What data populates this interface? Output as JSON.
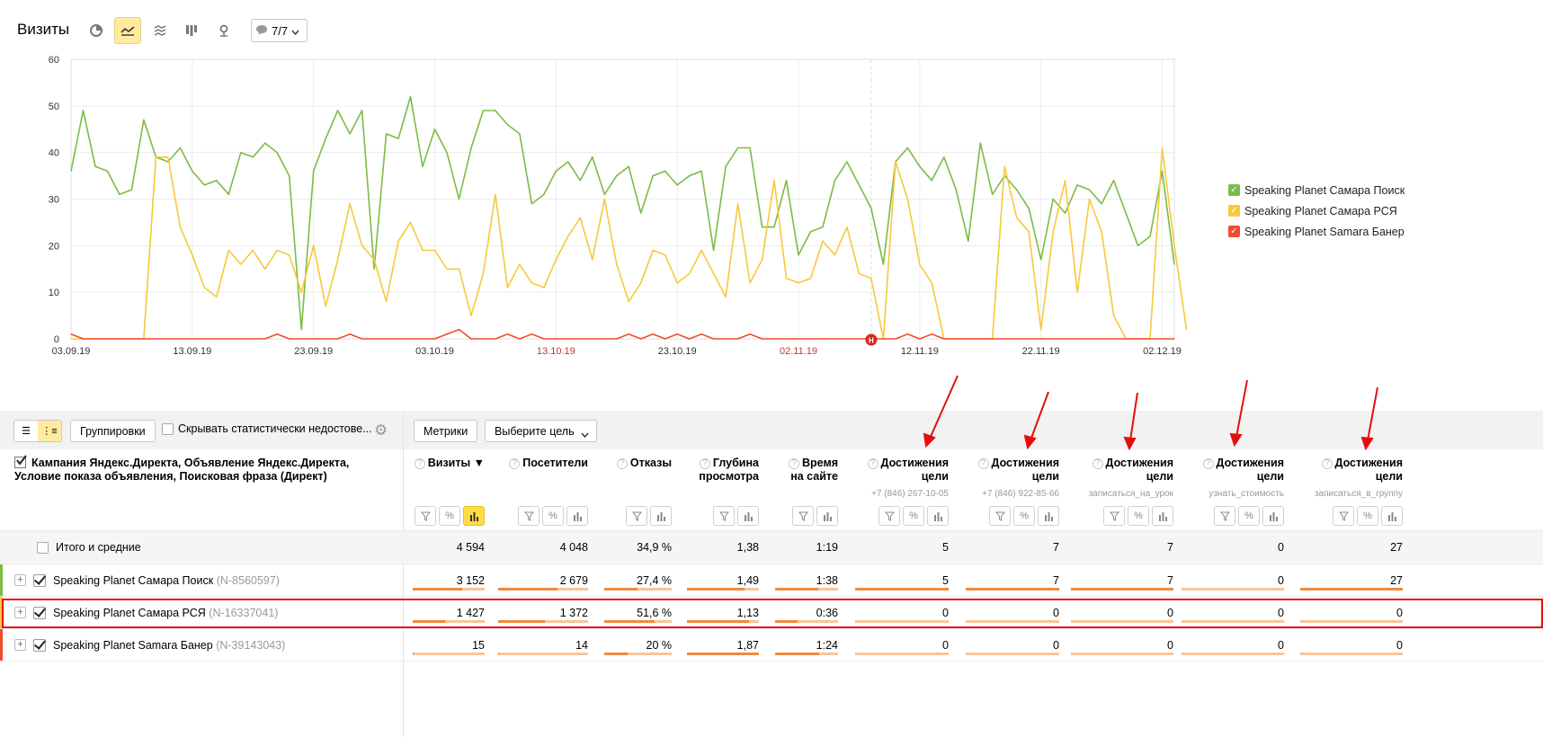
{
  "header": {
    "title": "Визиты",
    "annotations_label": "7/7",
    "tools": [
      "pie-chart-icon",
      "line-chart-icon",
      "area-chart-icon",
      "bar-chart-icon",
      "map-icon"
    ]
  },
  "chart_data": {
    "type": "line",
    "ylim": [
      0,
      60
    ],
    "yticks": [
      0,
      10,
      20,
      30,
      40,
      50,
      60
    ],
    "xtick_labels": [
      "03.09.19",
      "13.09.19",
      "23.09.19",
      "03.10.19",
      "13.10.19",
      "23.10.19",
      "02.11.19",
      "12.11.19",
      "22.11.19",
      "02.12.19"
    ],
    "weekend_labels": [
      "13.10.19",
      "02.11.19"
    ],
    "annotation_marker": "Н",
    "grid": true,
    "legend_position": "right",
    "series": [
      {
        "name": "Speaking Planet Самара Поиск",
        "color": "#7cbb45",
        "values": [
          36,
          49,
          37,
          36,
          31,
          32,
          47,
          39,
          38,
          41,
          36,
          33,
          34,
          31,
          40,
          39,
          42,
          40,
          35,
          2,
          36,
          43,
          49,
          44,
          49,
          15,
          44,
          43,
          52,
          37,
          45,
          40,
          30,
          41,
          49,
          49,
          46,
          44,
          29,
          31,
          36,
          38,
          34,
          39,
          31,
          35,
          37,
          27,
          35,
          36,
          33,
          35,
          36,
          19,
          37,
          41,
          41,
          24,
          24,
          34,
          18,
          23,
          24,
          34,
          38,
          33,
          28,
          16,
          38,
          41,
          37,
          34,
          39,
          32,
          21,
          42,
          31,
          35,
          32,
          28,
          17,
          30,
          27,
          33,
          32,
          29,
          34,
          27,
          20,
          22,
          36,
          16
        ]
      },
      {
        "name": "Speaking Planet Самара РСЯ",
        "color": "#f7c93a",
        "values": [
          0,
          0,
          0,
          0,
          0,
          0,
          0,
          39,
          39,
          24,
          18,
          11,
          9,
          19,
          16,
          19,
          15,
          19,
          18,
          10,
          20,
          7,
          17,
          29,
          20,
          17,
          8,
          21,
          25,
          19,
          19,
          15,
          15,
          5,
          14,
          31,
          11,
          16,
          12,
          11,
          17,
          22,
          26,
          17,
          30,
          16,
          8,
          12,
          19,
          18,
          12,
          14,
          19,
          14,
          9,
          29,
          12,
          17,
          34,
          13,
          12,
          13,
          21,
          18,
          24,
          14,
          13,
          0,
          38,
          30,
          16,
          12,
          0,
          0,
          0,
          0,
          0,
          37,
          26,
          23,
          2,
          23,
          34,
          10,
          30,
          23,
          5,
          0,
          0,
          0,
          41,
          20,
          2
        ]
      },
      {
        "name": "Speaking Planet Samara Банер",
        "color": "#f24b2f",
        "values": [
          1,
          0,
          0,
          0,
          0,
          0,
          0,
          0,
          0,
          0,
          0,
          0,
          0,
          0,
          0,
          0,
          0,
          1,
          0,
          0,
          0,
          0,
          0,
          1,
          0,
          0,
          0,
          0,
          0,
          0,
          0,
          1,
          2,
          0,
          0,
          0,
          1,
          0,
          1,
          0,
          0,
          0,
          0,
          0,
          0,
          0,
          1,
          0,
          1,
          0,
          1,
          0,
          1,
          0,
          0,
          0,
          1,
          0,
          0,
          0,
          0,
          0,
          0,
          0,
          0,
          0,
          0,
          0,
          0,
          1,
          0,
          1,
          0,
          0,
          0,
          0,
          0,
          0,
          0,
          0,
          0,
          0,
          0,
          0,
          0,
          0,
          0,
          0,
          0,
          0,
          0,
          0
        ]
      }
    ]
  },
  "toolbar": {
    "groupings_label": "Группировки",
    "hide_label": "Скрывать статистически недостове...",
    "metrics_label": "Метрики",
    "goal_label": "Выберите цель"
  },
  "table": {
    "dimension_header": "Кампания Яндекс.Директа, Объявление Яндекс.Директа, Условие показа объявления, Поисковая фраза (Директ)",
    "columns": [
      {
        "title": "Визиты ▼",
        "sub": ""
      },
      {
        "title": "Посетители",
        "sub": ""
      },
      {
        "title": "Отказы",
        "sub": ""
      },
      {
        "title": "Глубина просмотра",
        "sub": ""
      },
      {
        "title": "Время на сайте",
        "sub": ""
      },
      {
        "title": "Достижения цели",
        "sub": "+7 (846) 267-10-05"
      },
      {
        "title": "Достижения цели",
        "sub": "+7 (846) 922-85-66"
      },
      {
        "title": "Достижения цели",
        "sub": "записаться_на_урок"
      },
      {
        "title": "Достижения цели",
        "sub": "узнать_стоимость"
      },
      {
        "title": "Достижения цели",
        "sub": "записаться_в_группу"
      }
    ],
    "totals": {
      "label": "Итого и средние",
      "values": [
        "4 594",
        "4 048",
        "34,9 %",
        "1,38",
        "1:19",
        "5",
        "7",
        "7",
        "0",
        "27"
      ]
    },
    "rows": [
      {
        "name": "Speaking Planet Самара Поиск",
        "id": "(N-8560597)",
        "color": "#7cbb45",
        "values": [
          "3 152",
          "2 679",
          "27,4 %",
          "1,49",
          "1:38",
          "5",
          "7",
          "7",
          "0",
          "27"
        ],
        "fractions": [
          0.69,
          0.66,
          0.49,
          0.8,
          0.68,
          1,
          1,
          1,
          0,
          1
        ]
      },
      {
        "name": "Speaking Planet Самара РСЯ",
        "id": "(N-16337041)",
        "color": "#f7c93a",
        "values": [
          "1 427",
          "1 372",
          "51,6 %",
          "1,13",
          "0:36",
          "0",
          "0",
          "0",
          "0",
          "0"
        ],
        "fractions": [
          0.45,
          0.52,
          0.74,
          0.86,
          0.35,
          0,
          0,
          0,
          0,
          0
        ]
      },
      {
        "name": "Speaking Planet Samara Банер",
        "id": "(N-39143043)",
        "color": "#f24b2f",
        "values": [
          "15",
          "14",
          "20 %",
          "1,87",
          "1:24",
          "0",
          "0",
          "0",
          "0",
          "0"
        ],
        "fractions": [
          0.01,
          0.01,
          0.35,
          1,
          0.7,
          0,
          0,
          0,
          0,
          0
        ]
      }
    ]
  }
}
